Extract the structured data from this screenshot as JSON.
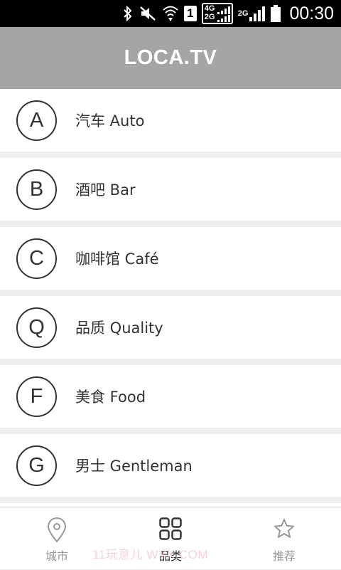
{
  "status_bar": {
    "time": "00:30",
    "sim_slot": "1",
    "network_top": "4G",
    "network_bottom": "2G",
    "network_2": "2G",
    "icons": [
      "bluetooth-icon",
      "mute-icon",
      "wifi-icon",
      "sim-icon",
      "signal-icon",
      "battery-icon"
    ]
  },
  "app_bar": {
    "title": "LOCA.TV"
  },
  "categories": [
    {
      "letter": "A",
      "label": "汽车 Auto"
    },
    {
      "letter": "B",
      "label": "酒吧 Bar"
    },
    {
      "letter": "C",
      "label": "咖啡馆 Café"
    },
    {
      "letter": "Q",
      "label": "品质 Quality"
    },
    {
      "letter": "F",
      "label": "美食 Food"
    },
    {
      "letter": "G",
      "label": "男士 Gentleman"
    }
  ],
  "bottom_nav": {
    "items": [
      {
        "label": "城市",
        "icon": "location-pin-icon",
        "active": false
      },
      {
        "label": "品类",
        "icon": "grid-icon",
        "active": true
      },
      {
        "label": "推荐",
        "icon": "star-icon",
        "active": false
      }
    ]
  },
  "watermark": "11玩意儿 WYX.COM",
  "colors": {
    "app_bar": "#a5a5a5",
    "divider": "#ededed",
    "text": "#333333",
    "nav_inactive": "#999999"
  }
}
